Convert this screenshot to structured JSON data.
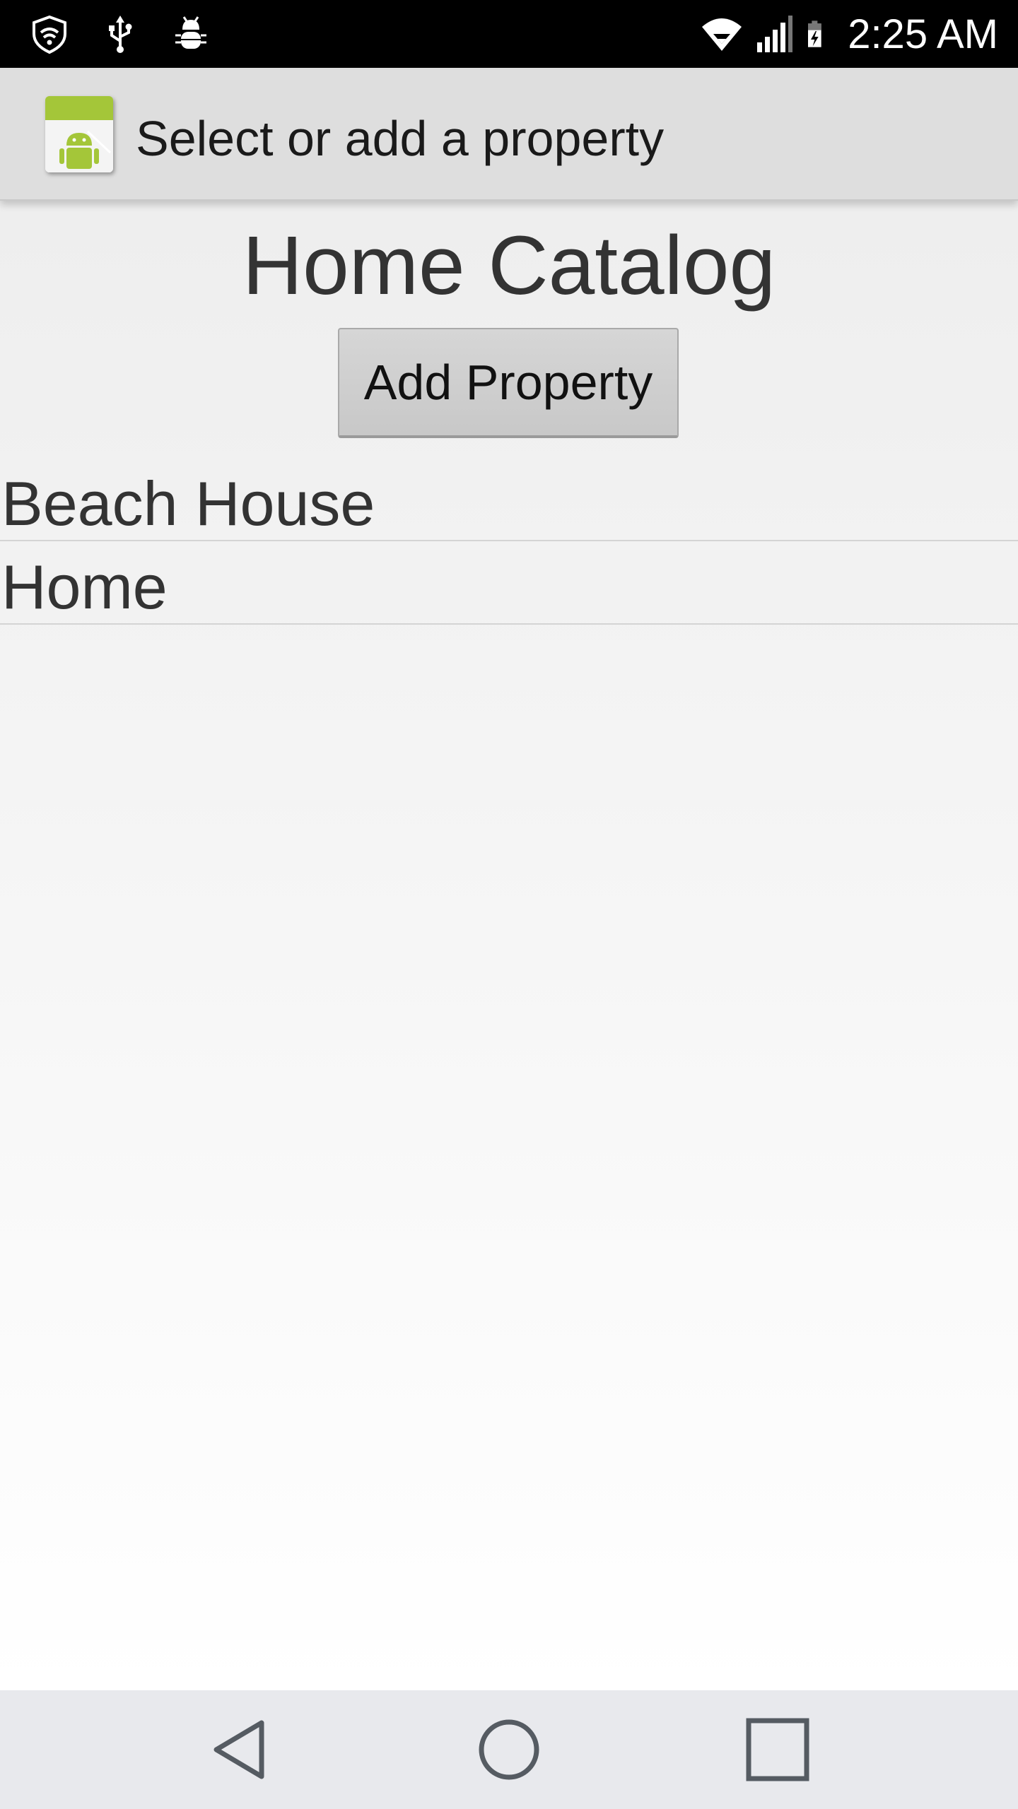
{
  "status_bar": {
    "time": "2:25 AM",
    "left_icons": [
      "shield-wifi-icon",
      "usb-icon",
      "bug-icon"
    ],
    "right_icons": [
      "wifi-icon",
      "signal-icon",
      "battery-charging-icon"
    ]
  },
  "action_bar": {
    "app_icon": "android-app-icon",
    "title": "Select or add a property"
  },
  "main": {
    "title": "Home Catalog",
    "add_button_label": "Add Property",
    "properties": [
      {
        "label": "Beach House"
      },
      {
        "label": "Home"
      }
    ]
  },
  "nav_bar": {
    "icons": [
      "back-icon",
      "home-icon",
      "recents-icon"
    ]
  },
  "colors": {
    "status_bar_bg": "#000000",
    "action_bar_bg": "#dedede",
    "button_bg": "#cccccc",
    "nav_bar_bg": "#e8e9ed",
    "text_dark": "#333333"
  }
}
